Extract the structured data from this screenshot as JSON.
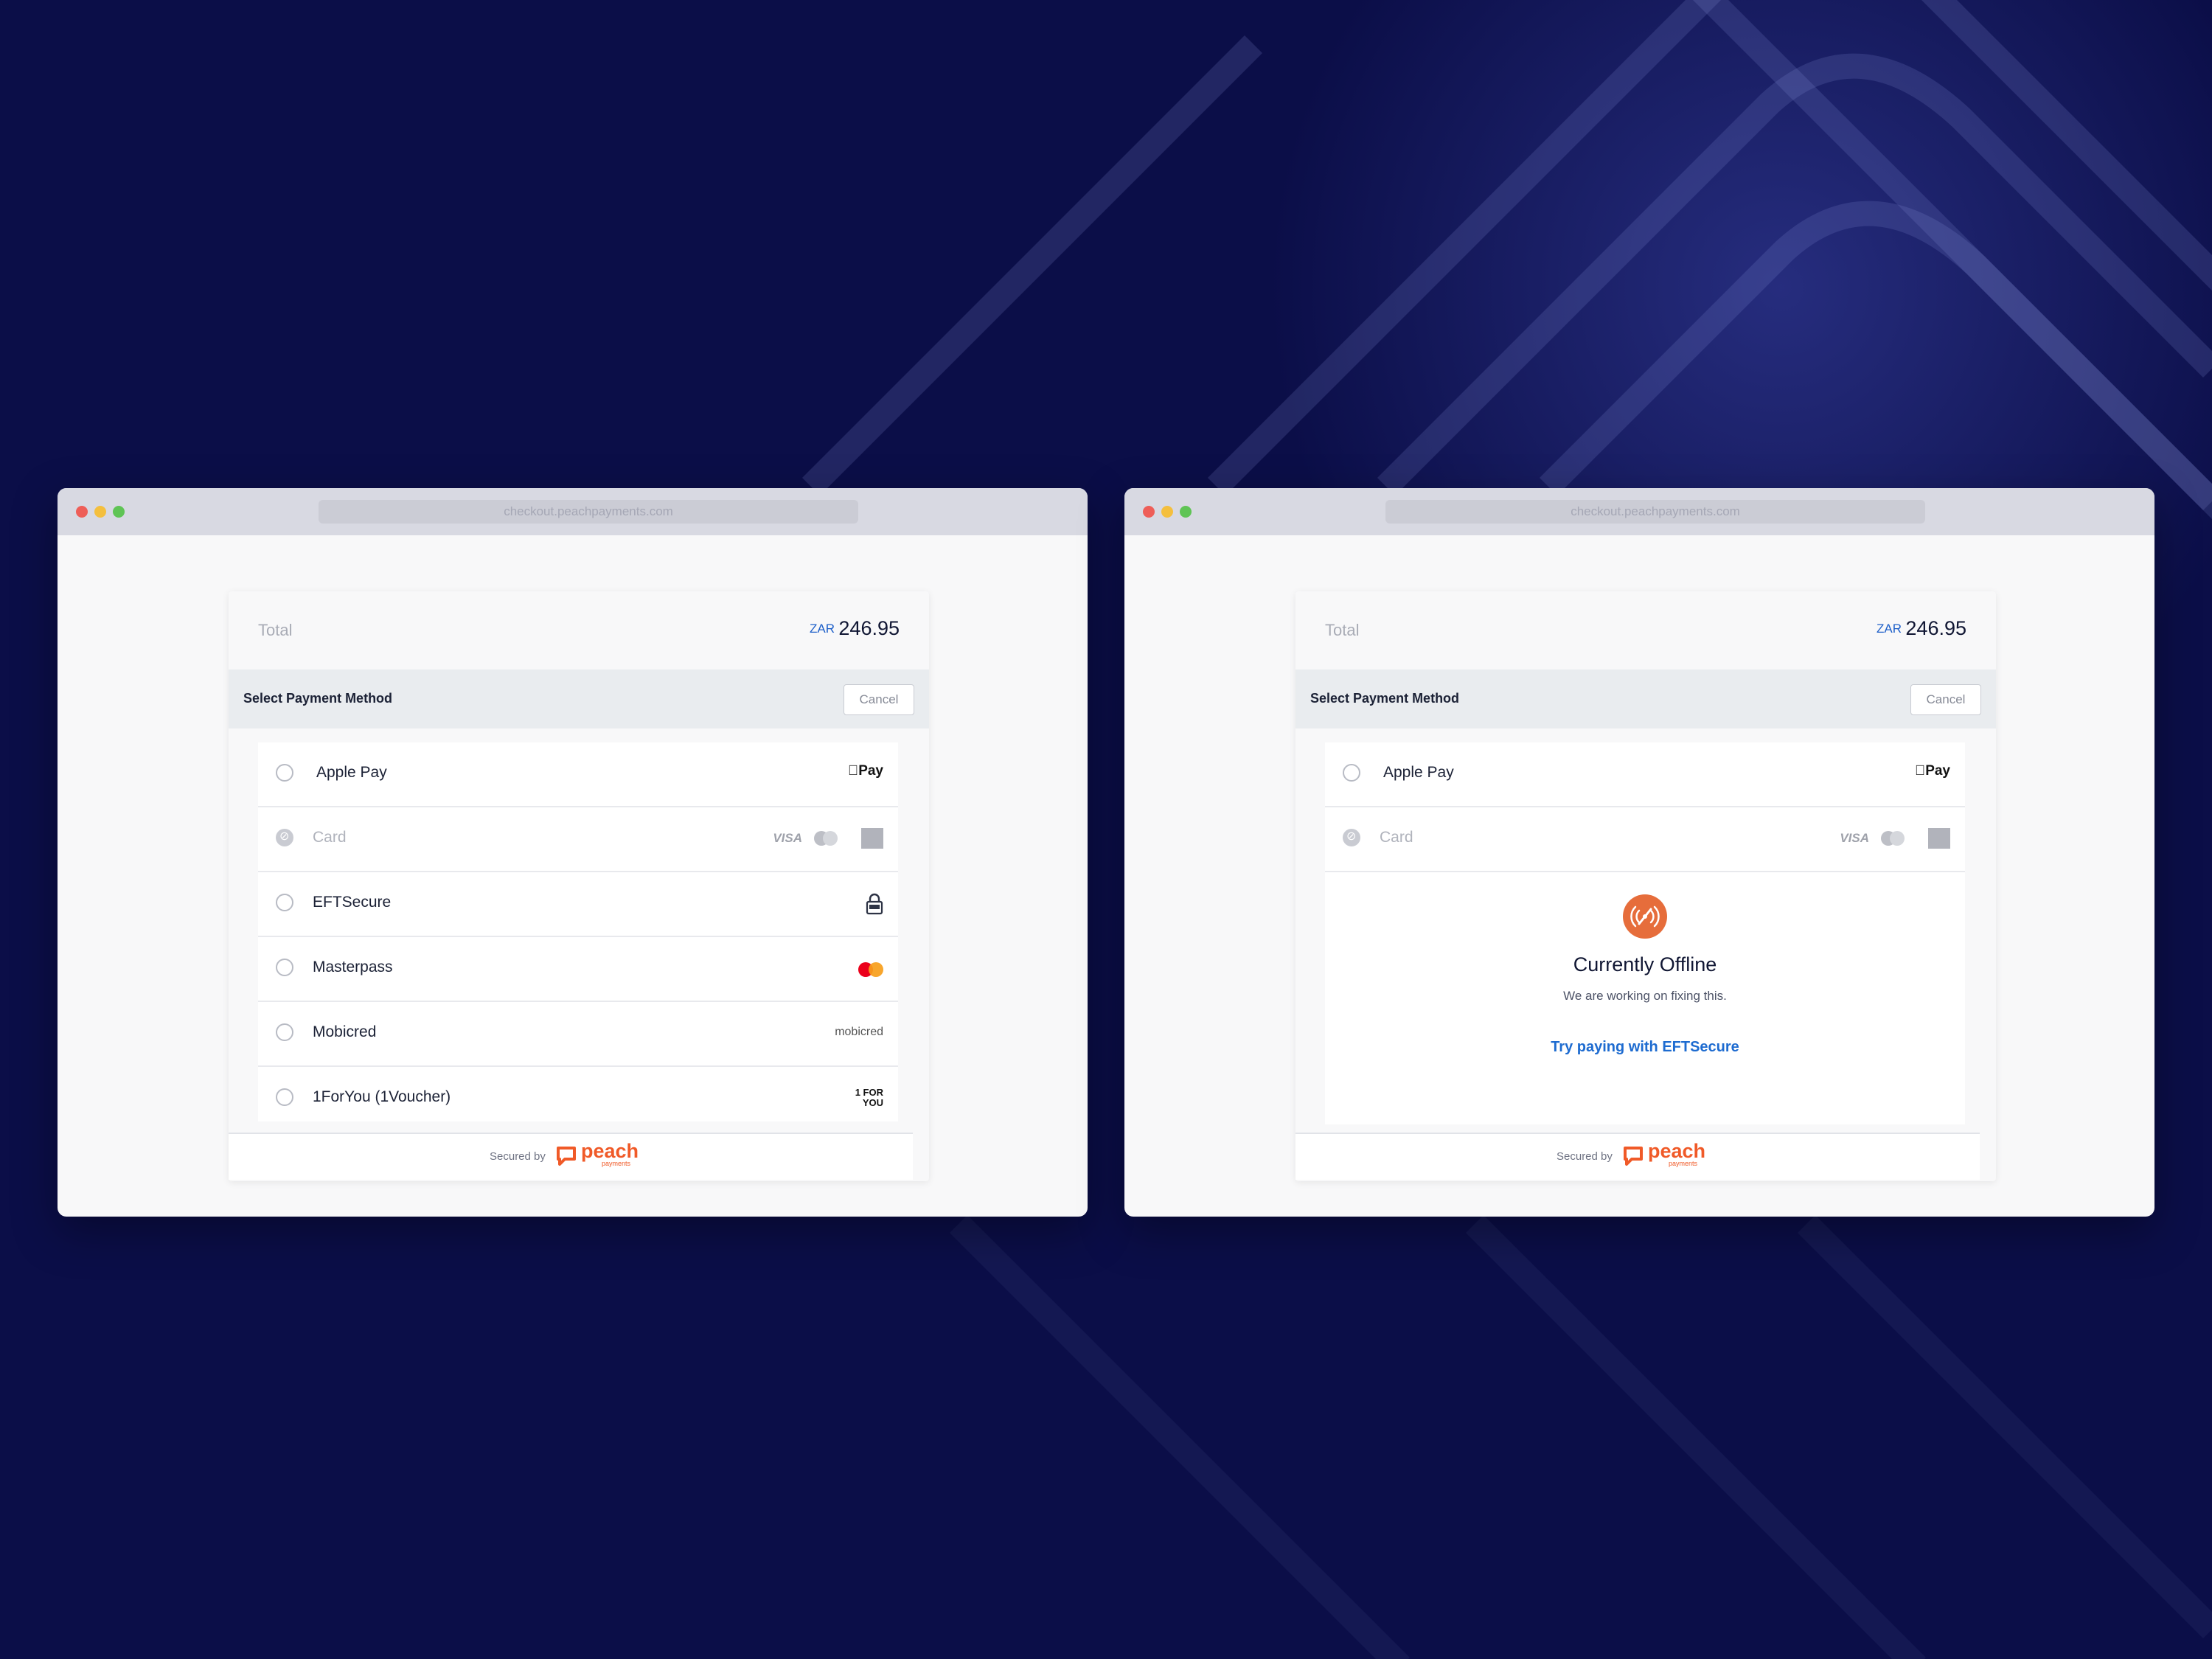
{
  "colors": {
    "background": "#0b0e48",
    "accent": "#1d5fc9",
    "peach": "#f05a28",
    "offline": "#e66d3b"
  },
  "windows": [
    {
      "url": "checkout.peachpayments.com",
      "total_label": "Total",
      "currency": "ZAR",
      "amount": "246.95",
      "method_title": "Select Payment Method",
      "cancel_label": "Cancel",
      "methods": [
        {
          "label": "Apple Pay",
          "icon": "apple-pay-logo",
          "icon_text": "Pay",
          "disabled": false
        },
        {
          "label": "Card",
          "icon": "card-brands-logos",
          "icon_text": "VISA",
          "disabled": true
        },
        {
          "label": "EFTSecure",
          "icon": "eft-lock-icon",
          "disabled": false
        },
        {
          "label": "Masterpass",
          "icon": "mastercard-logo",
          "disabled": false
        },
        {
          "label": "Mobicred",
          "icon": "mobicred-logo",
          "icon_text": "mobicred",
          "disabled": false
        },
        {
          "label": "1ForYou (1Voucher)",
          "icon": "1foryou-logo",
          "icon_text": "1 FOR YOU",
          "disabled": false
        }
      ],
      "secured_by": "Secured by",
      "brand": "peach",
      "brand_sub": "payments"
    },
    {
      "url": "checkout.peachpayments.com",
      "total_label": "Total",
      "currency": "ZAR",
      "amount": "246.95",
      "method_title": "Select Payment Method",
      "cancel_label": "Cancel",
      "methods": [
        {
          "label": "Apple Pay",
          "icon": "apple-pay-logo",
          "icon_text": "Pay",
          "disabled": false
        },
        {
          "label": "Card",
          "icon": "card-brands-logos",
          "icon_text": "VISA",
          "disabled": true
        }
      ],
      "offline": {
        "icon": "no-signal-icon",
        "title": "Currently Offline",
        "subtitle": "We are working on fixing this.",
        "link": "Try paying with EFTSecure"
      },
      "secured_by": "Secured by",
      "brand": "peach",
      "brand_sub": "payments"
    }
  ]
}
